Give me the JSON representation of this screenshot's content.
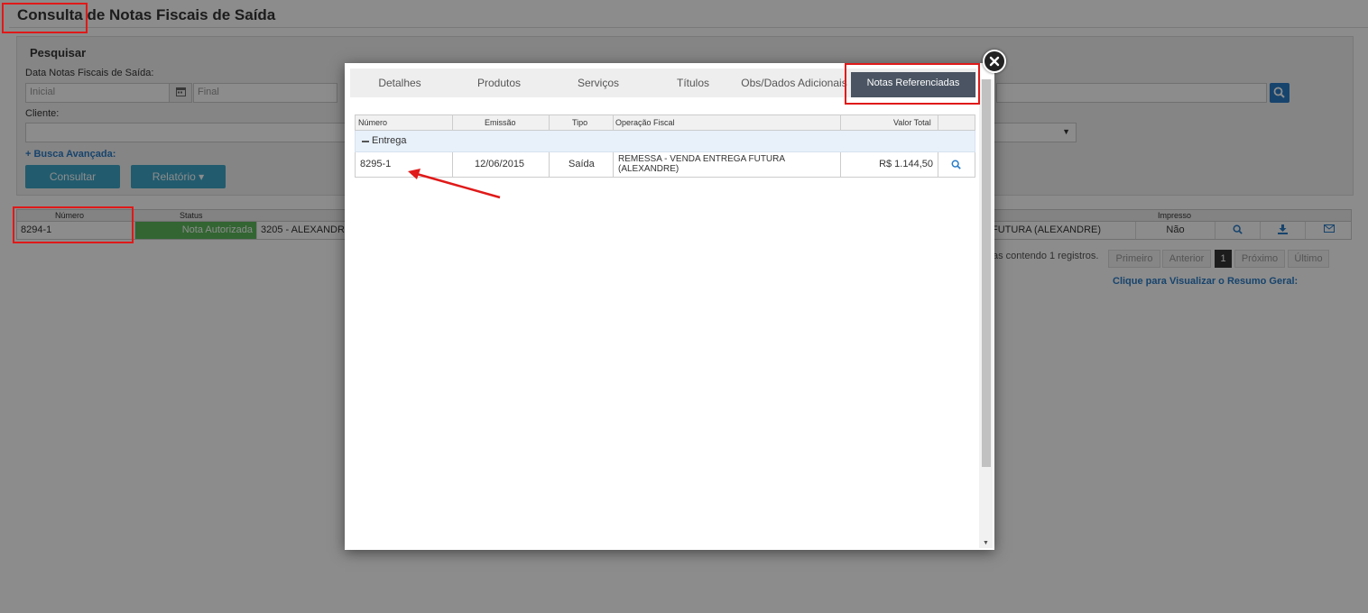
{
  "page": {
    "title": "Consulta de Notas Fiscais de Saída",
    "panel_title": "Pesquisar",
    "date_label": "Data Notas Fiscais de Saída:",
    "date_start_placeholder": "Inicial",
    "date_end_placeholder": "Final",
    "client_label": "Cliente:",
    "advanced_search": "+ Busca Avançada:",
    "consult_button": "Consultar",
    "report_button": "Relatório ▾",
    "grid": {
      "headers": {
        "numero": "Número",
        "status": "Status",
        "impresso": "Impresso"
      },
      "row": {
        "numero": "8294-1",
        "status": "Nota Autorizada",
        "client": "3205 - ALEXANDRE",
        "operation": "FUTURA (ALEXANDRE)",
        "impresso": "Não"
      }
    },
    "pager_text": "as contendo 1 registros.",
    "pager": {
      "first": "Primeiro",
      "prev": "Anterior",
      "current": "1",
      "next": "Próximo",
      "last": "Último"
    },
    "resume_link": "Clique para Visualizar o Resumo Geral:"
  },
  "modal": {
    "tabs": [
      "Detalhes",
      "Produtos",
      "Serviços",
      "Títulos",
      "Obs/Dados Adicionais",
      "Notas Referenciadas"
    ],
    "active_tab": "Notas Referenciadas",
    "table": {
      "headers": [
        "Número",
        "Emissão",
        "Tipo",
        "Operação Fiscal",
        "Valor Total"
      ],
      "group": "Entrega",
      "rows": [
        {
          "numero": "8295-1",
          "emissao": "12/06/2015",
          "tipo": "Saída",
          "operacao_line1": "REMESSA - VENDA ENTREGA FUTURA",
          "operacao_line2": "(ALEXANDRE)",
          "valor": "R$ 1.144,50"
        }
      ]
    }
  },
  "colors": {
    "accent_blue": "#2a7cc7",
    "teal_button": "#3fa7c8",
    "status_green": "#5cb85c",
    "active_tab": "#4a5462",
    "highlight_red": "#e01919"
  },
  "icons": [
    "calendar-icon",
    "search-icon",
    "download-icon",
    "envelope-icon",
    "close-icon",
    "collapse-minus-icon",
    "arrow-annotation"
  ]
}
